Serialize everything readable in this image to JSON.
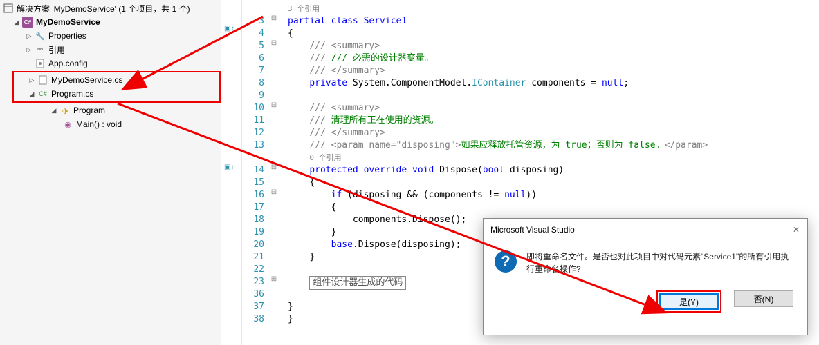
{
  "solution": {
    "title": "解决方案 'MyDemoService' (1 个项目，共 1 个)",
    "project": "MyDemoService",
    "properties": "Properties",
    "references": "引用",
    "appconfig": "App.config",
    "servicefile": "MyDemoService.cs",
    "programfile": "Program.cs",
    "programclass": "Program",
    "mainmethod": "Main() : void"
  },
  "code": {
    "refs1": "3 个引用",
    "line3": "partial class Service1",
    "line4": "{",
    "line5": "/// <summary>",
    "line6": "/// 必需的设计器变量。",
    "line7": "/// </summary>",
    "line8_1": "private",
    "line8_2": " System.ComponentModel.",
    "line8_3": "IContainer",
    "line8_4": " components = ",
    "line8_5": "null",
    "line8_6": ";",
    "line10": "/// <summary>",
    "line11": "/// 清理所有正在使用的资源。",
    "line12": "/// </summary>",
    "line13_1": "/// <param name=",
    "line13_2": "\"disposing\"",
    "line13_3": ">",
    "line13_4": "如果应释放托管资源，为 true；否则为 false。",
    "line13_5": "</param>",
    "refs2": "0 个引用",
    "line14_1": "protected override void",
    "line14_2": " Dispose(",
    "line14_3": "bool",
    "line14_4": " disposing)",
    "line15": "{",
    "line16_1": "if",
    "line16_2": " (disposing && (components != ",
    "line16_3": "null",
    "line16_4": "))",
    "line17": "{",
    "line18": "components.Dispose();",
    "line19": "}",
    "line20_1": "base",
    "line20_2": ".Dispose(disposing);",
    "line21": "}",
    "line23": "组件设计器生成的代码",
    "line37": "}",
    "line38": "}",
    "numbers": [
      "3",
      "4",
      "5",
      "6",
      "7",
      "8",
      "9",
      "10",
      "11",
      "12",
      "13",
      "14",
      "15",
      "16",
      "17",
      "18",
      "19",
      "20",
      "21",
      "22",
      "23",
      "36",
      "37",
      "38"
    ]
  },
  "dialog": {
    "title": "Microsoft Visual Studio",
    "message": "即将重命名文件。是否也对此项目中对代码元素\"Service1\"的所有引用执行重命名操作?",
    "yes": "是(Y)",
    "no": "否(N)"
  }
}
